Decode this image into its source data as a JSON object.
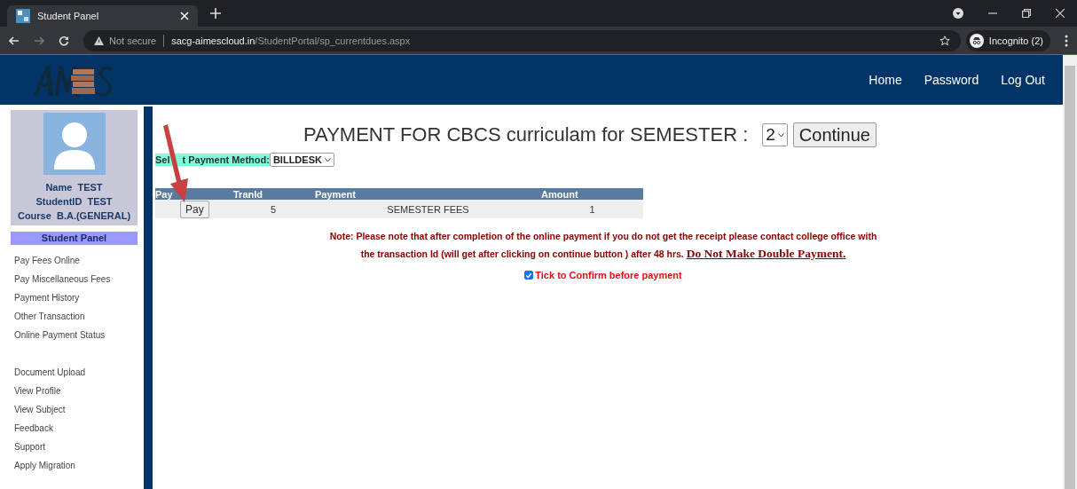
{
  "browser": {
    "tab_title": "Student Panel",
    "security": "Not secure",
    "url_host": "sacg-aimescloud.in",
    "url_path": "/StudentPortal/sp_currentdues.aspx",
    "profile": "Incognito (2)"
  },
  "header": {
    "nav": [
      "Home",
      "Password",
      "Log Out"
    ]
  },
  "sidebar": {
    "profile": [
      {
        "label": "Name",
        "value": "TEST"
      },
      {
        "label": "StudentID",
        "value": "TEST"
      },
      {
        "label": "Course",
        "value": "B.A.(GENERAL)"
      }
    ],
    "panel_title": "Student Panel",
    "menu_groups": [
      [
        "Pay Fees Online",
        "Pay Miscellaneous Fees",
        "Payment History",
        "Other Transaction",
        "Online Payment Status"
      ],
      [
        "Document Upload",
        "View Profile",
        "View Subject",
        "Feedback",
        "Support",
        "Apply Migration"
      ]
    ]
  },
  "main": {
    "title": "PAYMENT FOR CBCS curriculam for SEMESTER :",
    "semester": "2",
    "continue_button": "Continue",
    "method_label": [
      "Sel",
      "t Payment Method:"
    ],
    "method": "BILLDESK",
    "table": {
      "columns": [
        "Pay",
        "TranId",
        "Payment",
        "Amount"
      ],
      "rows": [
        {
          "pay": "Pay",
          "tranid": "5",
          "payment": "SEMESTER FEES",
          "amount": "1"
        }
      ]
    },
    "note": "Note: Please note that after completion of the online payment if you do not get the receipt please contact college office with the transaction Id (will get after clicking on continue button ) after 48 hrs.",
    "warning": "Do Not Make Double Payment.",
    "confirm": {
      "checked": true,
      "label": "Tick to Confirm before payment"
    }
  }
}
